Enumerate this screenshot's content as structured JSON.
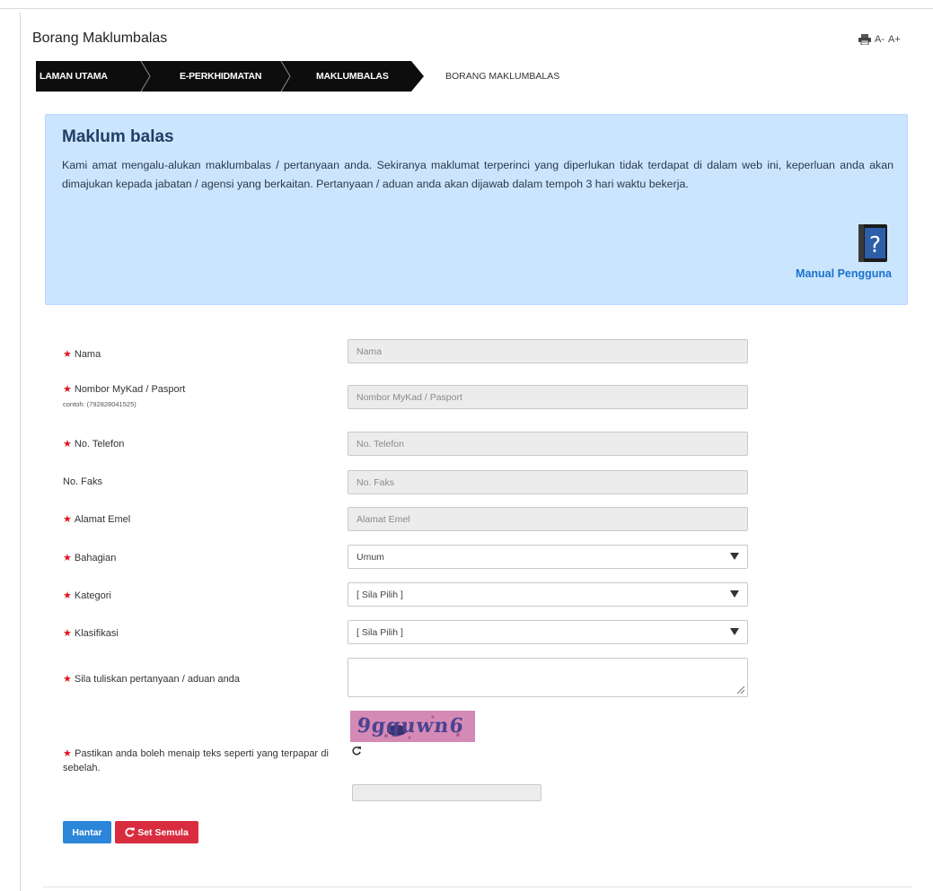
{
  "page": {
    "title": "Borang Maklumbalas",
    "font_small": "A-",
    "font_large": "A+"
  },
  "breadcrumb": [
    "LAMAN UTAMA",
    "E-PERKHIDMATAN",
    "MAKLUMBALAS",
    "BORANG MAKLUMBALAS"
  ],
  "info": {
    "heading": "Maklum balas",
    "text": "Kami amat mengalu-alukan maklumbalas / pertanyaan anda. Sekiranya maklumat terperinci yang diperlukan tidak terdapat di dalam web ini, keperluan anda akan dimajukan kepada jabatan / agensi yang berkaitan. Pertanyaan / aduan anda akan dijawab dalam tempoh 3 hari waktu bekerja.",
    "manual_link": "Manual Pengguna"
  },
  "form": {
    "required_mark": "★",
    "nama": {
      "label": "Nama",
      "placeholder": "Nama"
    },
    "mykad": {
      "label": "Nombor MyKad / Pasport",
      "hint": "contoh: (792828041525)",
      "placeholder": "Nombor MyKad / Pasport"
    },
    "telefon": {
      "label": "No. Telefon",
      "placeholder": "No. Telefon"
    },
    "faks": {
      "label": "No. Faks",
      "placeholder": "No. Faks"
    },
    "emel": {
      "label": "Alamat Emel",
      "placeholder": "Alamat Emel"
    },
    "bahagian": {
      "label": "Bahagian",
      "value": "Umum"
    },
    "kategori": {
      "label": "Kategori",
      "value": "[ Sila Pilih ]"
    },
    "klasifikasi": {
      "label": "Klasifikasi",
      "value": "[ Sila Pilih ]"
    },
    "pertanyaan": {
      "label": "Sila tuliskan pertanyaan / aduan anda"
    },
    "captcha": {
      "label": "Pastikan anda boleh menaip teks seperti yang terpapar di sebelah.",
      "text": "9gquwn6"
    }
  },
  "buttons": {
    "submit": "Hantar",
    "reset": "Set Semula"
  },
  "colors": {
    "panel_bg": "#cce5ff",
    "submit": "#2b86d9",
    "reset": "#d92d3f",
    "required": "#e0141e",
    "link": "#1a73c9"
  }
}
